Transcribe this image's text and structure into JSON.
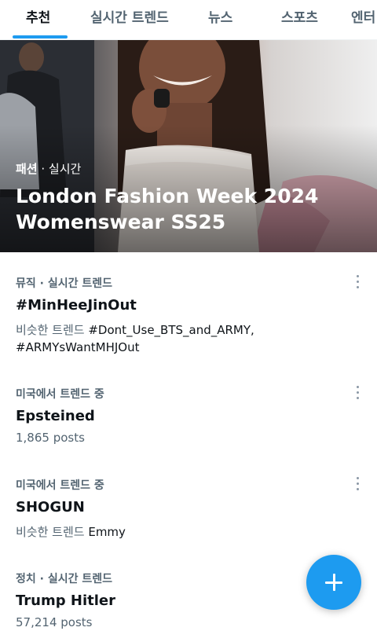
{
  "tabs": [
    {
      "label": "추천",
      "active": true
    },
    {
      "label": "실시간 트렌드",
      "active": false
    },
    {
      "label": "뉴스",
      "active": false
    },
    {
      "label": "스포츠",
      "active": false
    },
    {
      "label": "엔터",
      "active": false
    }
  ],
  "hero": {
    "category": "패션",
    "separator": " · ",
    "status": "실시간",
    "title": "London Fashion Week 2024 Womenswear SS25"
  },
  "trends": [
    {
      "meta": "뮤직 · 실시간 트렌드",
      "title": "#MinHeeJinOut",
      "similar_prefix": "비슷한 트렌드 ",
      "similar_tags": "#Dont_Use_BTS_and_ARMY, #ARMYsWantMHJOut"
    },
    {
      "meta": "미국에서 트렌드 중",
      "title": "Epsteined",
      "posts": "1,865 posts"
    },
    {
      "meta": "미국에서 트렌드 중",
      "title": "SHOGUN",
      "similar_prefix": "비슷한 트렌드 ",
      "similar_tags": "Emmy"
    },
    {
      "meta": "정치 · 실시간 트렌드",
      "title": "Trump Hitler",
      "posts": "57,214 posts"
    }
  ],
  "fab": {
    "icon": "plus-icon"
  },
  "colors": {
    "accent": "#1d9bf0",
    "text": "#0f1419",
    "secondary": "#536471"
  }
}
